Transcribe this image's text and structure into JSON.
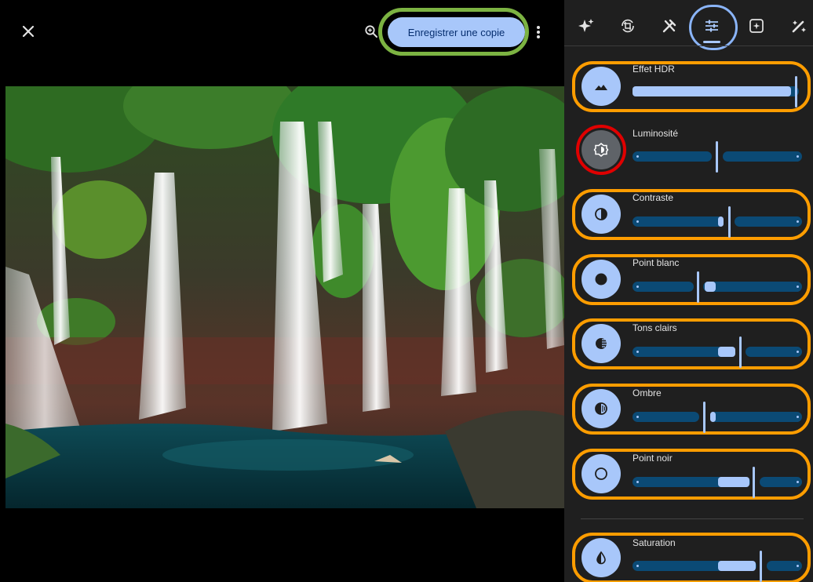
{
  "toolbar": {
    "save_label": "Enregistrer une copie"
  },
  "adjustments": [
    {
      "label": "Effet HDR",
      "value": 100
    },
    {
      "label": "Luminosité",
      "value": 50
    },
    {
      "label": "Contraste",
      "value": 57
    },
    {
      "label": "Point blanc",
      "value": 40
    },
    {
      "label": "Tons clairs",
      "value": 63
    },
    {
      "label": "Ombre",
      "value": 43
    },
    {
      "label": "Point noir",
      "value": 71
    },
    {
      "label": "Saturation",
      "value": 75
    }
  ],
  "colors": {
    "accent": "#a8c7fa",
    "track": "#0b4a75",
    "panel": "#1f1f1f",
    "highlight_orange": "#ff9d00",
    "highlight_green": "#7cb342",
    "highlight_red": "#e00000",
    "highlight_blue": "#8ab4f8"
  },
  "icons": {
    "close": "close-icon",
    "zoom": "zoom-in-icon",
    "more": "more-vert-icon",
    "tabs": [
      "auto-enhance-icon",
      "crop-rotate-icon",
      "tools-icon",
      "adjust-sliders-icon",
      "filters-icon",
      "markup-icon"
    ]
  }
}
